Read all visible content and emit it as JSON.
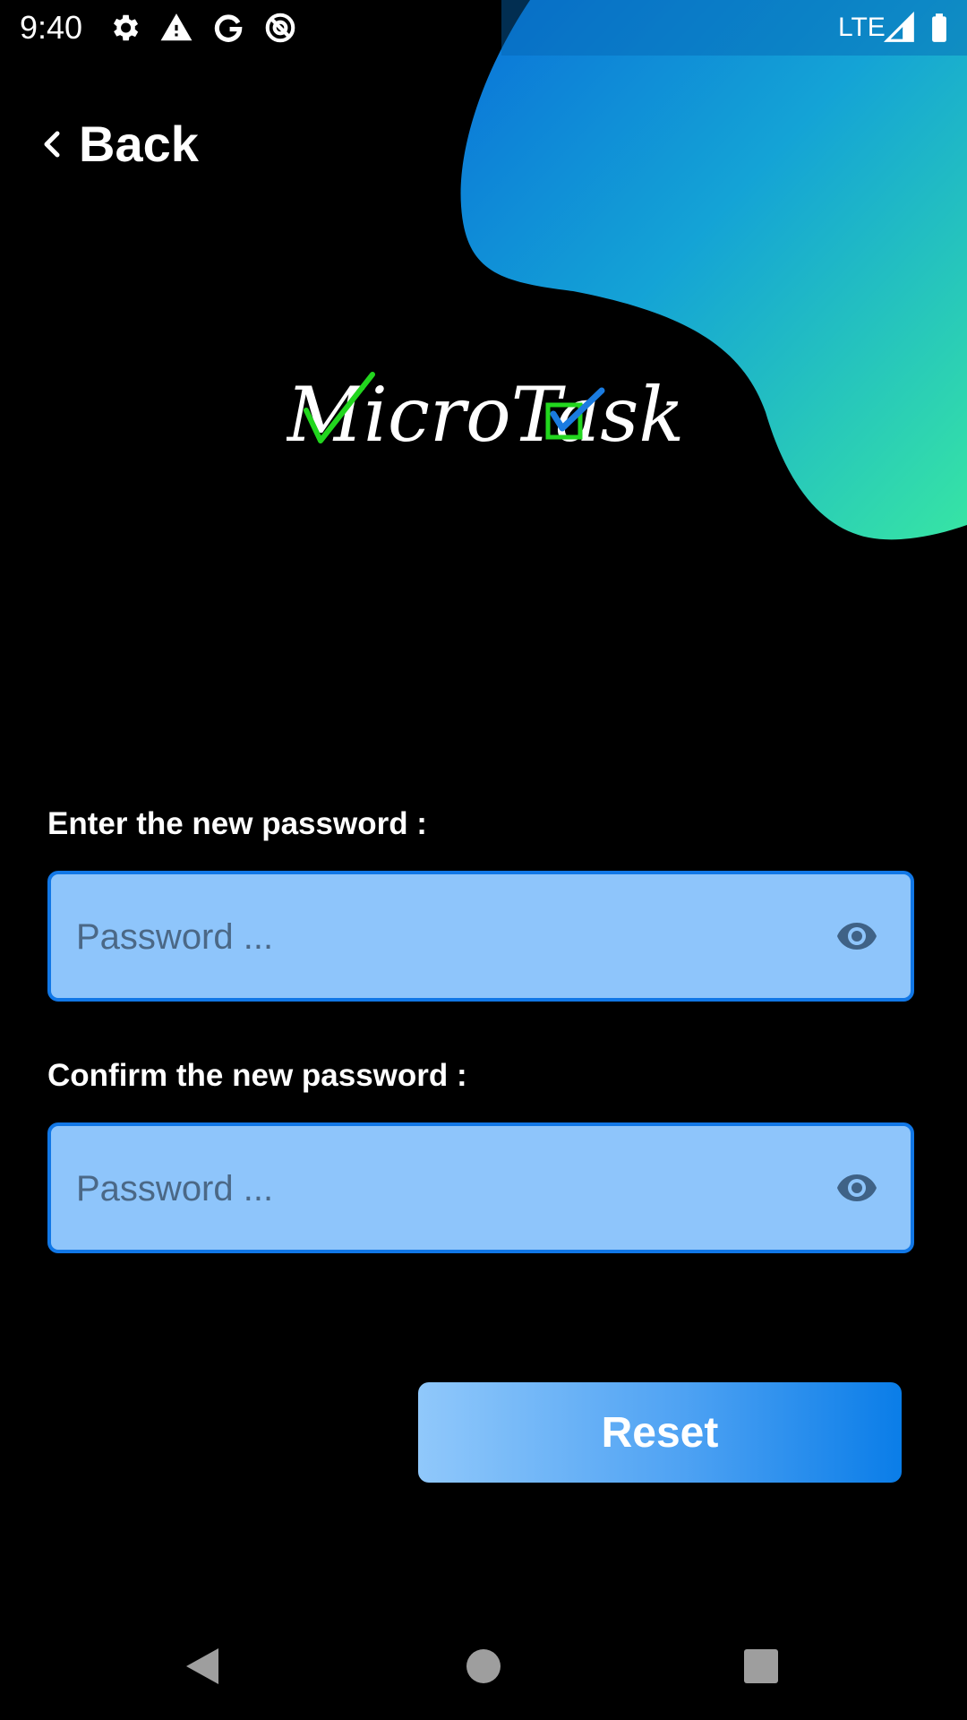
{
  "status_bar": {
    "time": "9:40",
    "network": "LTE",
    "icons": [
      "gear-icon",
      "warning-icon",
      "google-icon",
      "data-saver-icon",
      "signal-icon",
      "battery-icon"
    ]
  },
  "header": {
    "back_label": "Back"
  },
  "logo": {
    "text": "MicroTask"
  },
  "form": {
    "new_password": {
      "label": "Enter the new password :",
      "placeholder": "Password ..."
    },
    "confirm_password": {
      "label": "Confirm the new password :",
      "placeholder": "Password ..."
    },
    "submit_label": "Reset"
  },
  "nav_bar": {
    "buttons": [
      "back-triangle-icon",
      "home-circle-icon",
      "recents-square-icon"
    ]
  },
  "colors": {
    "background": "#000000",
    "blob_gradient_start": "#0b86e8",
    "blob_gradient_end": "#35e3a6",
    "field_fill": "#8ec5fb",
    "field_border": "#1177e6",
    "button_gradient_start": "#90c8fb",
    "button_gradient_end": "#0a7de8",
    "logo_check_green": "#22d61e",
    "logo_check_blue": "#1a7be0"
  }
}
